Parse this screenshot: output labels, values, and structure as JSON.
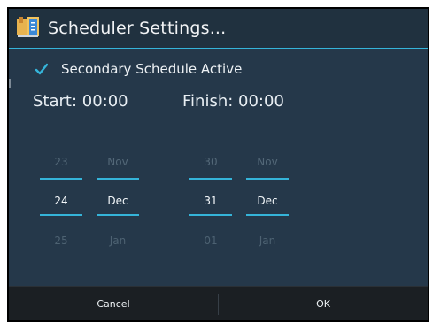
{
  "dialog": {
    "title": "Scheduler Settings...",
    "checkbox_label": "Secondary Schedule Active",
    "checkbox_checked": true,
    "start_label": "Start: 00:00",
    "finish_label": "Finish: 00:00"
  },
  "pickers": {
    "start_day": {
      "prev": "23",
      "current": "24",
      "next": "25"
    },
    "start_month": {
      "prev": "Nov",
      "current": "Dec",
      "next": "Jan"
    },
    "finish_day": {
      "prev": "30",
      "current": "31",
      "next": "01"
    },
    "finish_month": {
      "prev": "Nov",
      "current": "Dec",
      "next": "Jan"
    }
  },
  "buttons": {
    "cancel": "Cancel",
    "ok": "OK"
  },
  "colors": {
    "accent": "#35b4d9",
    "background": "#25384a",
    "footer": "#1b1f23"
  },
  "icons": {
    "app": "calendar-app-icon",
    "checkbox": "checkmark-icon"
  }
}
